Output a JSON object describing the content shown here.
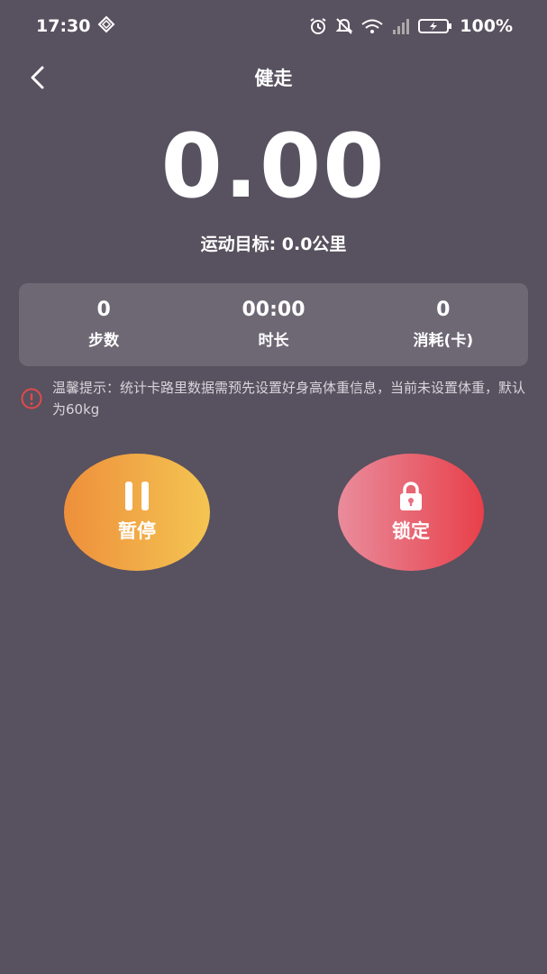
{
  "status_bar": {
    "time": "17:30",
    "battery": "100%"
  },
  "nav": {
    "title": "健走"
  },
  "distance": "0.00",
  "goal_text": "运动目标: 0.0公里",
  "stats": [
    {
      "value": "0",
      "label": "步数"
    },
    {
      "value": "00:00",
      "label": "时长"
    },
    {
      "value": "0",
      "label": "消耗(卡)"
    }
  ],
  "tip": {
    "text": "温馨提示：统计卡路里数据需预先设置好身高体重信息，当前未设置体重，默认为60kg",
    "icon": "alert-circle-icon",
    "color": "#e04a4a"
  },
  "buttons": {
    "pause_label": "暂停",
    "lock_label": "锁定"
  },
  "colors": {
    "background": "#58515f",
    "card": "#6e6875",
    "pause_gradient": [
      "#ee8f3b",
      "#f4c552"
    ],
    "lock_gradient": [
      "#e98c9c",
      "#e8404a"
    ]
  }
}
